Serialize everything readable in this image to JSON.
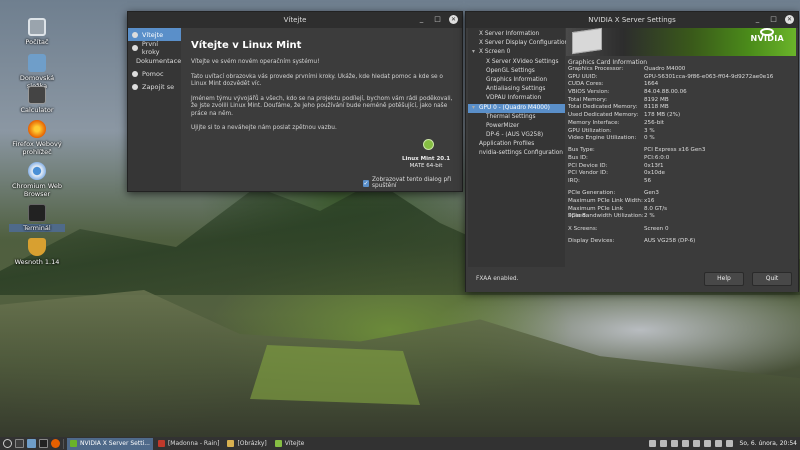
{
  "desktop": {
    "icons": [
      {
        "label": "Počítač"
      },
      {
        "label": "Domovská složka"
      },
      {
        "label": "Calculator"
      },
      {
        "label": "Firefox Webový prohlížeč"
      },
      {
        "label": "Chromium Web Browser"
      },
      {
        "label": "Terminál"
      },
      {
        "label": "Wesnoth 1.14"
      }
    ]
  },
  "welcome": {
    "title": "Vítejte",
    "sidebar": [
      {
        "label": "Vítejte"
      },
      {
        "label": "První kroky"
      },
      {
        "label": "Dokumentace"
      },
      {
        "label": "Pomoc"
      },
      {
        "label": "Zapojit se"
      }
    ],
    "heading": "Vítejte v Linux Mint",
    "paragraphs": [
      "Vítejte ve svém novém operačním systému!",
      "Tato uvítací obrazovka vás provede prvními kroky. Ukáže, kde hledat pomoc a kde se o Linux Mint dozvědět víc.",
      "Jménem týmu vývojářů a všech, kdo se na projektu podílejí, bychom vám rádi poděkovali, že jste zvolili Linux Mint. Doufáme, že jeho používání bude neméně potěšující, jako naše práce na něm.",
      "Ujijte si to a neváhejte nám poslat zpětnou vazbu."
    ],
    "version_name": "Linux Mint 20.1",
    "version_edition": "MATE 64-bit",
    "startup_label": "Zobrazovat tento dialog při spuštění"
  },
  "nvidia": {
    "title": "NVIDIA X Server Settings",
    "tree": [
      {
        "label": "X Server Information",
        "indent": 1
      },
      {
        "label": "X Server Display Configuration",
        "indent": 1
      },
      {
        "label": "X Screen 0",
        "indent": 0,
        "arrow": "▾"
      },
      {
        "label": "X Server XVideo Settings",
        "indent": 2
      },
      {
        "label": "OpenGL Settings",
        "indent": 2
      },
      {
        "label": "Graphics Information",
        "indent": 2
      },
      {
        "label": "Antialiasing Settings",
        "indent": 2
      },
      {
        "label": "VDPAU Information",
        "indent": 2
      },
      {
        "label": "GPU 0 - (Quadro M4000)",
        "indent": 0,
        "arrow": "▾",
        "selected": true
      },
      {
        "label": "Thermal Settings",
        "indent": 2
      },
      {
        "label": "PowerMizer",
        "indent": 2
      },
      {
        "label": "DP-6 - (AUS VG258)",
        "indent": 2
      },
      {
        "label": "Application Profiles",
        "indent": 1
      },
      {
        "label": "nvidia-settings Configuration",
        "indent": 1
      }
    ],
    "banner_logo": "NVIDIA",
    "section": "Graphics Card Information",
    "groups": [
      [
        {
          "k": "Graphics Processor:",
          "v": "Quadro M4000"
        },
        {
          "k": "GPU UUID:",
          "v": "GPU-56301cca-9f86-e063-ff04-9d9272ae0e16"
        },
        {
          "k": "CUDA Cores:",
          "v": "1664"
        },
        {
          "k": "VBIOS Version:",
          "v": "84.04.88.00.06"
        },
        {
          "k": "Total Memory:",
          "v": "8192 MB"
        },
        {
          "k": "Total Dedicated Memory:",
          "v": "8118 MB"
        },
        {
          "k": "Used Dedicated Memory:",
          "v": "178 MB (2%)"
        },
        {
          "k": "Memory Interface:",
          "v": "256-bit"
        },
        {
          "k": "GPU Utilization:",
          "v": "3 %"
        },
        {
          "k": "Video Engine Utilization:",
          "v": "0 %"
        }
      ],
      [
        {
          "k": "Bus Type:",
          "v": "PCI Express x16 Gen3"
        },
        {
          "k": "Bus ID:",
          "v": "PCI:6:0:0"
        },
        {
          "k": "PCI Device ID:",
          "v": "0x13f1"
        },
        {
          "k": "PCI Vendor ID:",
          "v": "0x10de"
        },
        {
          "k": "IRQ:",
          "v": "56"
        }
      ],
      [
        {
          "k": "PCIe Generation:",
          "v": "Gen3"
        },
        {
          "k": "Maximum PCIe Link Width:",
          "v": "x16"
        },
        {
          "k": "Maximum PCIe Link Speed:",
          "v": "8.0 GT/s"
        },
        {
          "k": "PCIe Bandwidth Utilization:",
          "v": "2 %"
        }
      ],
      [
        {
          "k": "X Screens:",
          "v": "Screen 0"
        }
      ],
      [
        {
          "k": "Display Devices:",
          "v": "AUS VG258 (DP-6)"
        }
      ]
    ],
    "status": "FXAA enabled.",
    "help_label": "Help",
    "quit_label": "Quit"
  },
  "taskbar": {
    "tasks": [
      {
        "label": "NVIDIA X Server Setti...",
        "active": true,
        "color": "#6ab42a"
      },
      {
        "label": "[Madonna - Rain]",
        "active": false,
        "color": "#c0392b"
      },
      {
        "label": "[Obrázky]",
        "active": false,
        "color": "#d8b050"
      },
      {
        "label": "Vítejte",
        "active": false,
        "color": "#86be43"
      }
    ],
    "clock": "So, 6. února, 20:54"
  },
  "colors": {
    "selection": "#5a8fc9",
    "mint_green": "#86be43",
    "nvidia_green": "#76b900"
  }
}
